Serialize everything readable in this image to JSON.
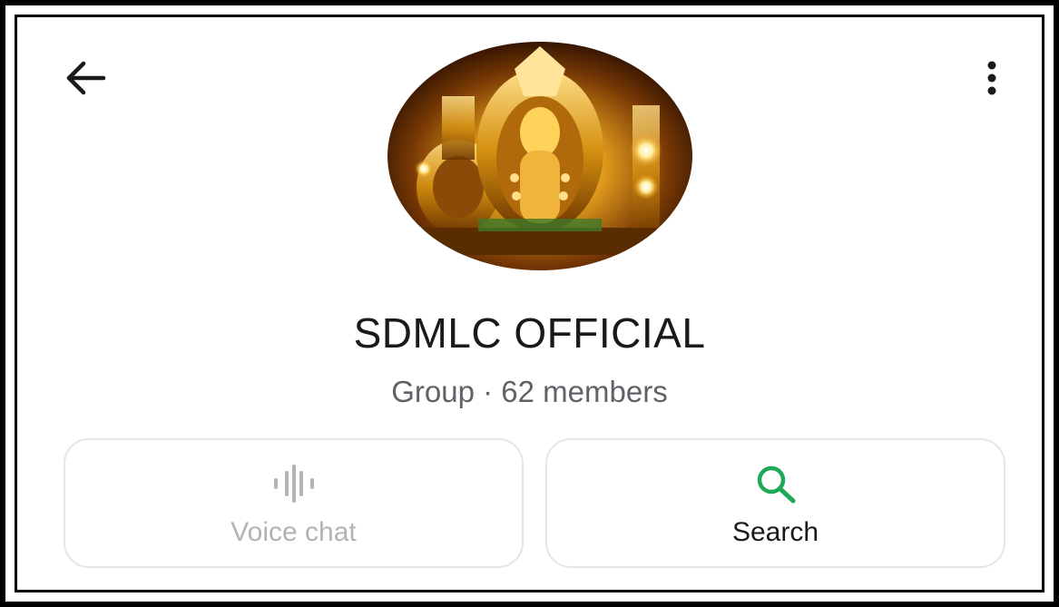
{
  "header": {
    "back_icon": "arrow-left-icon",
    "menu_icon": "more-vertical-icon"
  },
  "group": {
    "name": "SDMLC OFFICIAL",
    "subtitle": "Group · 62 members"
  },
  "actions": [
    {
      "label": "Voice chat",
      "icon": "voice-wave-icon",
      "enabled": false,
      "color": "#b3b3b3"
    },
    {
      "label": "Search",
      "icon": "search-icon",
      "enabled": true,
      "color": "#1fa855"
    }
  ]
}
